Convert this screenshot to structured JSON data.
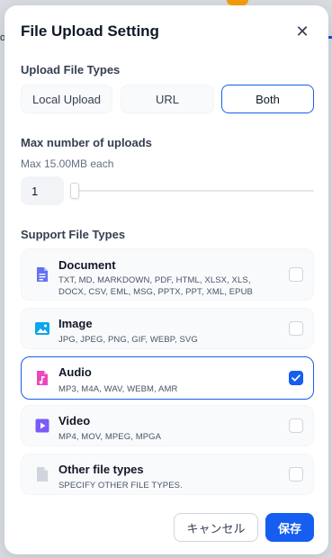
{
  "background": {
    "left_text": "o"
  },
  "modal": {
    "title": "File Upload Setting",
    "close_glyph": "✕"
  },
  "upload_types": {
    "label": "Upload File Types",
    "options": [
      "Local Upload",
      "URL",
      "Both"
    ],
    "selected": "Both"
  },
  "max_uploads": {
    "label": "Max number of uploads",
    "sub_label": "Max 15.00MB each",
    "value": "1",
    "slider_fraction": 0.0
  },
  "support_types": {
    "label": "Support File Types",
    "items": [
      {
        "name": "Document",
        "types": "TXT, MD, MARKDOWN, PDF, HTML, XLSX, XLS, DOCX, CSV, EML, MSG, PPTX, PPT, XML, EPUB",
        "checked": false,
        "icon": "document-icon",
        "color": "#6172f3"
      },
      {
        "name": "Image",
        "types": "JPG, JPEG, PNG, GIF, WEBP, SVG",
        "checked": false,
        "icon": "image-icon",
        "color": "#0ba5ec"
      },
      {
        "name": "Audio",
        "types": "MP3, M4A, WAV, WEBM, AMR",
        "checked": true,
        "icon": "audio-icon",
        "color": "#ee46bc"
      },
      {
        "name": "Video",
        "types": "MP4, MOV, MPEG, MPGA",
        "checked": false,
        "icon": "video-icon",
        "color": "#7a5af8"
      },
      {
        "name": "Other file types",
        "types": "SPECIFY OTHER FILE TYPES.",
        "checked": false,
        "icon": "other-file-icon",
        "color": "#d0d5dd"
      }
    ]
  },
  "actions": {
    "cancel_label": "キャンセル",
    "save_label": "保存"
  },
  "colors": {
    "accent": "#155eef"
  }
}
